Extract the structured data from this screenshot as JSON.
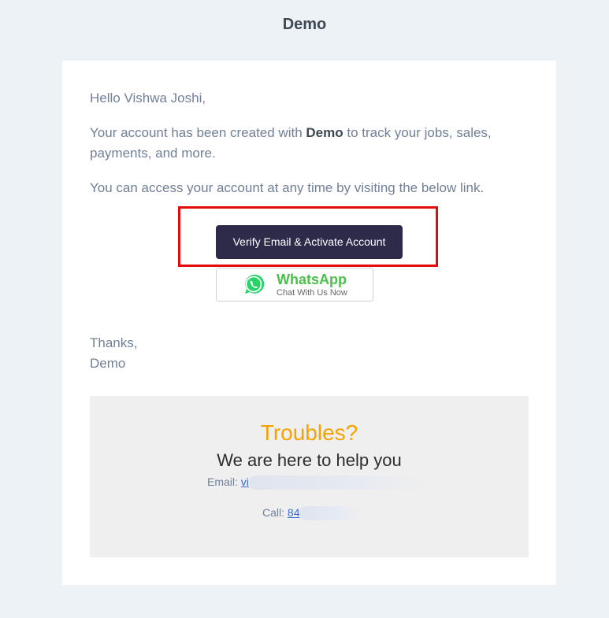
{
  "header": {
    "title": "Demo"
  },
  "email": {
    "greeting": "Hello Vishwa Joshi,",
    "created_prefix": "Your account has been created with ",
    "company": "Demo",
    "created_suffix": " to track your jobs, sales, payments, and more.",
    "access_text": "You can access your account at any time by visiting the below link.",
    "verify_button": "Verify Email & Activate Account",
    "whatsapp": {
      "title": "WhatsApp",
      "subtitle": "Chat With Us Now",
      "icon": "whatsapp-icon"
    },
    "thanks": "Thanks,",
    "signature": "Demo"
  },
  "help": {
    "title": "Troubles?",
    "subtitle": "We are here to help you",
    "email_label": "Email: ",
    "email_value": "vi",
    "call_label": "Call: ",
    "call_value": "84"
  },
  "colors": {
    "background": "#edf2f7",
    "button": "#2d2a4a",
    "highlight": "#e50b0b",
    "troubles": "#f5a300",
    "whatsapp": "#4bc04b",
    "link": "#3869d4"
  }
}
